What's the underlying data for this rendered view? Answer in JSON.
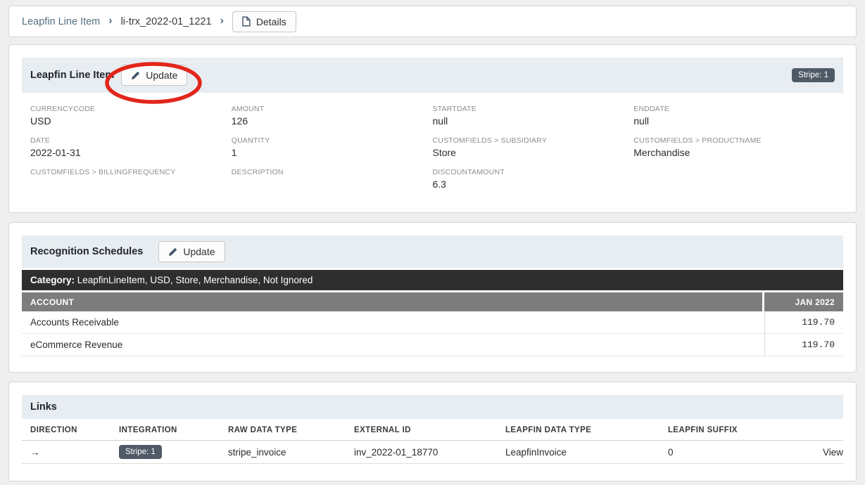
{
  "breadcrumb": {
    "root": "Leapfin Line Item",
    "separator": "›",
    "current": "li-trx_2022-01_1221",
    "details_button": "Details"
  },
  "line_item_card": {
    "title": "Leapfin Line Item",
    "update_button": "Update",
    "badge": "Stripe: 1",
    "fields": [
      {
        "label": "CURRENCYCODE",
        "value": "USD"
      },
      {
        "label": "AMOUNT",
        "value": "126"
      },
      {
        "label": "STARTDATE",
        "value": "null"
      },
      {
        "label": "ENDDATE",
        "value": "null"
      },
      {
        "label": "DATE",
        "value": "2022-01-31"
      },
      {
        "label": "QUANTITY",
        "value": "1"
      },
      {
        "label": "CUSTOMFIELDS > SUBSIDIARY",
        "value": "Store"
      },
      {
        "label": "CUSTOMFIELDS > PRODUCTNAME",
        "value": "Merchandise"
      },
      {
        "label": "CUSTOMFIELDS > BILLINGFREQUENCY",
        "value": ""
      },
      {
        "label": "DESCRIPTION",
        "value": ""
      },
      {
        "label": "DISCOUNTAMOUNT",
        "value": "6.3"
      }
    ]
  },
  "recognition_card": {
    "title": "Recognition Schedules",
    "update_button": "Update",
    "category_label": "Category:",
    "category_value": " LeapfinLineItem, USD, Store, Merchandise, Not Ignored",
    "table": {
      "account_header": "ACCOUNT",
      "period_header": "JAN 2022",
      "rows": [
        {
          "account": "Accounts Receivable",
          "amount": "119.70"
        },
        {
          "account": "eCommerce Revenue",
          "amount": "119.70"
        }
      ]
    }
  },
  "links_card": {
    "title": "Links",
    "columns": {
      "direction": "DIRECTION",
      "integration": "INTEGRATION",
      "raw_data_type": "RAW DATA TYPE",
      "external_id": "EXTERNAL ID",
      "leapfin_data_type": "LEAPFIN DATA TYPE",
      "leapfin_suffix": "LEAPFIN SUFFIX"
    },
    "rows": [
      {
        "direction": "→",
        "integration_badge": "Stripe: 1",
        "raw_data_type": "stripe_invoice",
        "external_id": "inv_2022-01_18770",
        "leapfin_data_type": "LeapfinInvoice",
        "leapfin_suffix": "0",
        "action": "View"
      }
    ]
  },
  "icons": {
    "details": "document-icon",
    "update": "pencil-icon",
    "direction": "arrow-right-icon"
  },
  "colors": {
    "page_background": "#efefef",
    "card_header_background": "#e8edf1",
    "breadcrumb_link": "#52707f",
    "badge_background": "#4f5a66",
    "category_bar_background": "#2e2e2e",
    "table_header_background": "#7d7d7d",
    "view_link_green": "#56a156",
    "annotation_red": "#e2261a"
  }
}
